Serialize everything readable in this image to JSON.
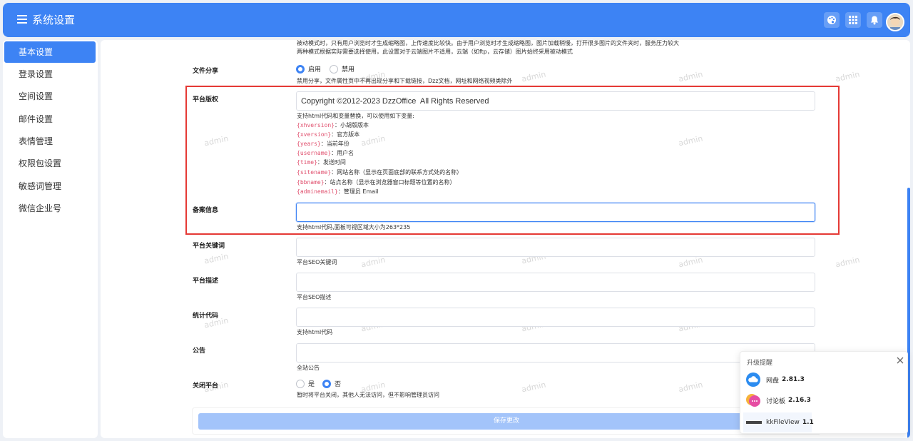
{
  "header": {
    "title": "系统设置",
    "icons": [
      "palette-icon",
      "apps-grid-icon",
      "bell-icon",
      "user-avatar"
    ]
  },
  "sidebar": {
    "items": [
      {
        "label": "基本设置",
        "active": true
      },
      {
        "label": "登录设置"
      },
      {
        "label": "空间设置"
      },
      {
        "label": "邮件设置"
      },
      {
        "label": "表情管理"
      },
      {
        "label": "权限包设置"
      },
      {
        "label": "敏感词管理"
      },
      {
        "label": "微信企业号"
      }
    ]
  },
  "main": {
    "top_text_1": "被动模式时，只有用户浏览时才生成缩略图，上传速度比较快。由于用户浏览时才生成缩略图，图片加载稍慢，打开很多图片的文件夹时，服务压力较大",
    "top_text_2": "两种模式根据实际需要选择使用，此设置对于云端图片不适用，云端（如ftp，云存储）图片始终采用被动模式",
    "file_share": {
      "label": "文件分享",
      "options": [
        "启用",
        "禁用"
      ],
      "selected": "启用",
      "hint": "禁用分享，文件属性页中不再出现分享和下载链接，Dzz文档，网址和网络视频类除外"
    },
    "copyright": {
      "label": "平台版权",
      "value": "Copyright ©2012-2023 DzzOffice  All Rights Reserved",
      "hint": "支持html代码和变量替换，可以使用如下变量:",
      "vars": [
        {
          "code": "{xhversion}",
          "desc": "：小胡版版本"
        },
        {
          "code": "{xversion}",
          "desc": "：官方版本"
        },
        {
          "code": "{years}",
          "desc": "：当前年份"
        },
        {
          "code": "{username}",
          "desc": "：用户名"
        },
        {
          "code": "{time}",
          "desc": "：发送时间"
        },
        {
          "code": "{sitename}",
          "desc": "：网站名称（显示在页面底部的联系方式处的名称）"
        },
        {
          "code": "{bbname}",
          "desc": "：站点名称（显示在浏览器窗口标题等位置的名称）"
        },
        {
          "code": "{adminemail}",
          "desc": "：管理员 Email"
        }
      ]
    },
    "icp": {
      "label": "备案信息",
      "value": "",
      "hint": "支持html代码,面板可视区域大小为263*235"
    },
    "keywords": {
      "label": "平台关键词",
      "value": "",
      "hint": "平台SEO关键词"
    },
    "description": {
      "label": "平台描述",
      "value": "",
      "hint": "平台SEO描述"
    },
    "stats_code": {
      "label": "统计代码",
      "value": "",
      "hint": "支持html代码"
    },
    "notice": {
      "label": "公告",
      "value": "",
      "hint": "全站公告"
    },
    "close_platform": {
      "label": "关闭平台",
      "options": [
        "是",
        "否"
      ],
      "selected": "否",
      "hint": "暂时将平台关闭，其他人无法访问，但不影响管理员访问"
    },
    "save_label": "保存更改",
    "watermark": "admin"
  },
  "popup": {
    "title": "升级提醒",
    "items": [
      {
        "name": "网盘",
        "version": "2.81.3"
      },
      {
        "name": "讨论板",
        "version": "2.16.3"
      },
      {
        "name": "kkFileView",
        "version": "1.1"
      }
    ]
  },
  "colors": {
    "primary": "#3d83f4",
    "highlight_border": "#e53935",
    "variable_code": "#e0506e",
    "save_button": "#a3c4fa"
  }
}
